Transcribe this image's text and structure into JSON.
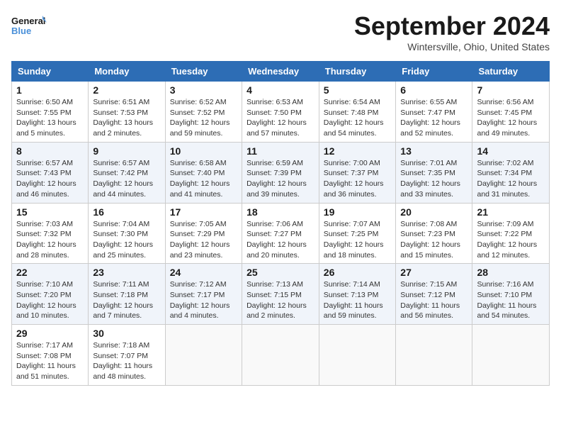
{
  "header": {
    "logo_line1": "General",
    "logo_line2": "Blue",
    "month": "September 2024",
    "location": "Wintersville, Ohio, United States"
  },
  "weekdays": [
    "Sunday",
    "Monday",
    "Tuesday",
    "Wednesday",
    "Thursday",
    "Friday",
    "Saturday"
  ],
  "weeks": [
    [
      {
        "day": "1",
        "info": "Sunrise: 6:50 AM\nSunset: 7:55 PM\nDaylight: 13 hours\nand 5 minutes."
      },
      {
        "day": "2",
        "info": "Sunrise: 6:51 AM\nSunset: 7:53 PM\nDaylight: 13 hours\nand 2 minutes."
      },
      {
        "day": "3",
        "info": "Sunrise: 6:52 AM\nSunset: 7:52 PM\nDaylight: 12 hours\nand 59 minutes."
      },
      {
        "day": "4",
        "info": "Sunrise: 6:53 AM\nSunset: 7:50 PM\nDaylight: 12 hours\nand 57 minutes."
      },
      {
        "day": "5",
        "info": "Sunrise: 6:54 AM\nSunset: 7:48 PM\nDaylight: 12 hours\nand 54 minutes."
      },
      {
        "day": "6",
        "info": "Sunrise: 6:55 AM\nSunset: 7:47 PM\nDaylight: 12 hours\nand 52 minutes."
      },
      {
        "day": "7",
        "info": "Sunrise: 6:56 AM\nSunset: 7:45 PM\nDaylight: 12 hours\nand 49 minutes."
      }
    ],
    [
      {
        "day": "8",
        "info": "Sunrise: 6:57 AM\nSunset: 7:43 PM\nDaylight: 12 hours\nand 46 minutes."
      },
      {
        "day": "9",
        "info": "Sunrise: 6:57 AM\nSunset: 7:42 PM\nDaylight: 12 hours\nand 44 minutes."
      },
      {
        "day": "10",
        "info": "Sunrise: 6:58 AM\nSunset: 7:40 PM\nDaylight: 12 hours\nand 41 minutes."
      },
      {
        "day": "11",
        "info": "Sunrise: 6:59 AM\nSunset: 7:39 PM\nDaylight: 12 hours\nand 39 minutes."
      },
      {
        "day": "12",
        "info": "Sunrise: 7:00 AM\nSunset: 7:37 PM\nDaylight: 12 hours\nand 36 minutes."
      },
      {
        "day": "13",
        "info": "Sunrise: 7:01 AM\nSunset: 7:35 PM\nDaylight: 12 hours\nand 33 minutes."
      },
      {
        "day": "14",
        "info": "Sunrise: 7:02 AM\nSunset: 7:34 PM\nDaylight: 12 hours\nand 31 minutes."
      }
    ],
    [
      {
        "day": "15",
        "info": "Sunrise: 7:03 AM\nSunset: 7:32 PM\nDaylight: 12 hours\nand 28 minutes."
      },
      {
        "day": "16",
        "info": "Sunrise: 7:04 AM\nSunset: 7:30 PM\nDaylight: 12 hours\nand 25 minutes."
      },
      {
        "day": "17",
        "info": "Sunrise: 7:05 AM\nSunset: 7:29 PM\nDaylight: 12 hours\nand 23 minutes."
      },
      {
        "day": "18",
        "info": "Sunrise: 7:06 AM\nSunset: 7:27 PM\nDaylight: 12 hours\nand 20 minutes."
      },
      {
        "day": "19",
        "info": "Sunrise: 7:07 AM\nSunset: 7:25 PM\nDaylight: 12 hours\nand 18 minutes."
      },
      {
        "day": "20",
        "info": "Sunrise: 7:08 AM\nSunset: 7:23 PM\nDaylight: 12 hours\nand 15 minutes."
      },
      {
        "day": "21",
        "info": "Sunrise: 7:09 AM\nSunset: 7:22 PM\nDaylight: 12 hours\nand 12 minutes."
      }
    ],
    [
      {
        "day": "22",
        "info": "Sunrise: 7:10 AM\nSunset: 7:20 PM\nDaylight: 12 hours\nand 10 minutes."
      },
      {
        "day": "23",
        "info": "Sunrise: 7:11 AM\nSunset: 7:18 PM\nDaylight: 12 hours\nand 7 minutes."
      },
      {
        "day": "24",
        "info": "Sunrise: 7:12 AM\nSunset: 7:17 PM\nDaylight: 12 hours\nand 4 minutes."
      },
      {
        "day": "25",
        "info": "Sunrise: 7:13 AM\nSunset: 7:15 PM\nDaylight: 12 hours\nand 2 minutes."
      },
      {
        "day": "26",
        "info": "Sunrise: 7:14 AM\nSunset: 7:13 PM\nDaylight: 11 hours\nand 59 minutes."
      },
      {
        "day": "27",
        "info": "Sunrise: 7:15 AM\nSunset: 7:12 PM\nDaylight: 11 hours\nand 56 minutes."
      },
      {
        "day": "28",
        "info": "Sunrise: 7:16 AM\nSunset: 7:10 PM\nDaylight: 11 hours\nand 54 minutes."
      }
    ],
    [
      {
        "day": "29",
        "info": "Sunrise: 7:17 AM\nSunset: 7:08 PM\nDaylight: 11 hours\nand 51 minutes."
      },
      {
        "day": "30",
        "info": "Sunrise: 7:18 AM\nSunset: 7:07 PM\nDaylight: 11 hours\nand 48 minutes."
      },
      null,
      null,
      null,
      null,
      null
    ]
  ]
}
